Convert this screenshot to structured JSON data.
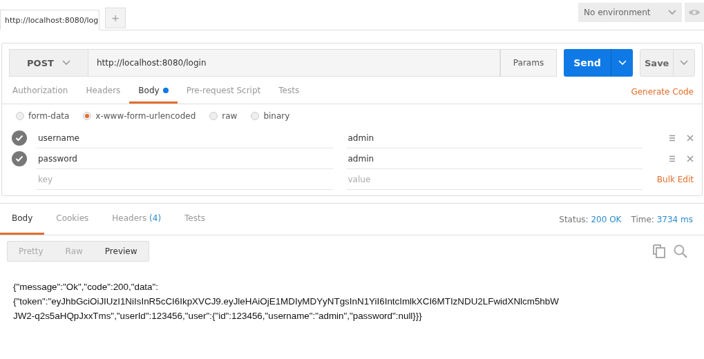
{
  "tabs": [
    {
      "label": "http://localhost:8080/log",
      "selected": true
    }
  ],
  "new_tab": "+",
  "environment": {
    "value": "No environment"
  },
  "request": {
    "method": "POST",
    "url": "http://localhost:8080/login",
    "params": "Params",
    "send": "Send",
    "save": "Save"
  },
  "request_tabs": [
    {
      "label": "Authorization",
      "selected": false,
      "dot": false
    },
    {
      "label": "Headers",
      "selected": false,
      "dot": false
    },
    {
      "label": "Body",
      "selected": true,
      "dot": true
    },
    {
      "label": "Pre-request Script",
      "selected": false,
      "dot": false
    },
    {
      "label": "Tests",
      "selected": false,
      "dot": false
    }
  ],
  "generate_code": "Generate Code",
  "body_types": [
    {
      "label": "form-data",
      "selected": false
    },
    {
      "label": "x-www-form-urlencoded",
      "selected": true
    },
    {
      "label": "raw",
      "selected": false
    },
    {
      "label": "binary",
      "selected": false
    }
  ],
  "params": [
    {
      "key": "username",
      "value": "admin",
      "checked": true
    },
    {
      "key": "password",
      "value": "admin",
      "checked": true
    }
  ],
  "new_param": {
    "key_placeholder": "key",
    "value_placeholder": "value"
  },
  "bulk_edit": "Bulk Edit",
  "response_tabs": [
    {
      "label": "Body",
      "selected": true
    },
    {
      "label": "Cookies",
      "selected": false
    },
    {
      "label": "Headers",
      "count": "(4)",
      "selected": false
    },
    {
      "label": "Tests",
      "selected": false
    }
  ],
  "status": {
    "label": "Status:",
    "value": "200 OK"
  },
  "time": {
    "label": "Time:",
    "value": "3734 ms"
  },
  "view_modes": [
    {
      "label": "Pretty",
      "selected": false
    },
    {
      "label": "Raw",
      "selected": false
    },
    {
      "label": "Preview",
      "selected": true
    }
  ],
  "response_lines": [
    "{\"message\":\"Ok\",\"code\":200,\"data\":",
    "{\"token\":\"eyJhbGciOiJIUzI1NiIsInR5cCI6IkpXVCJ9.eyJleHAiOjE1MDIyMDYyNTgsInN1YiI6IntcImlkXCI6MTIzNDU2LFwidXNlcm5hbW",
    "JW2-q2s5aHQpJxxTms\",\"userId\":123456,\"user\":{\"id\":123456,\"username\":\"admin\",\"password\":null}}}"
  ]
}
